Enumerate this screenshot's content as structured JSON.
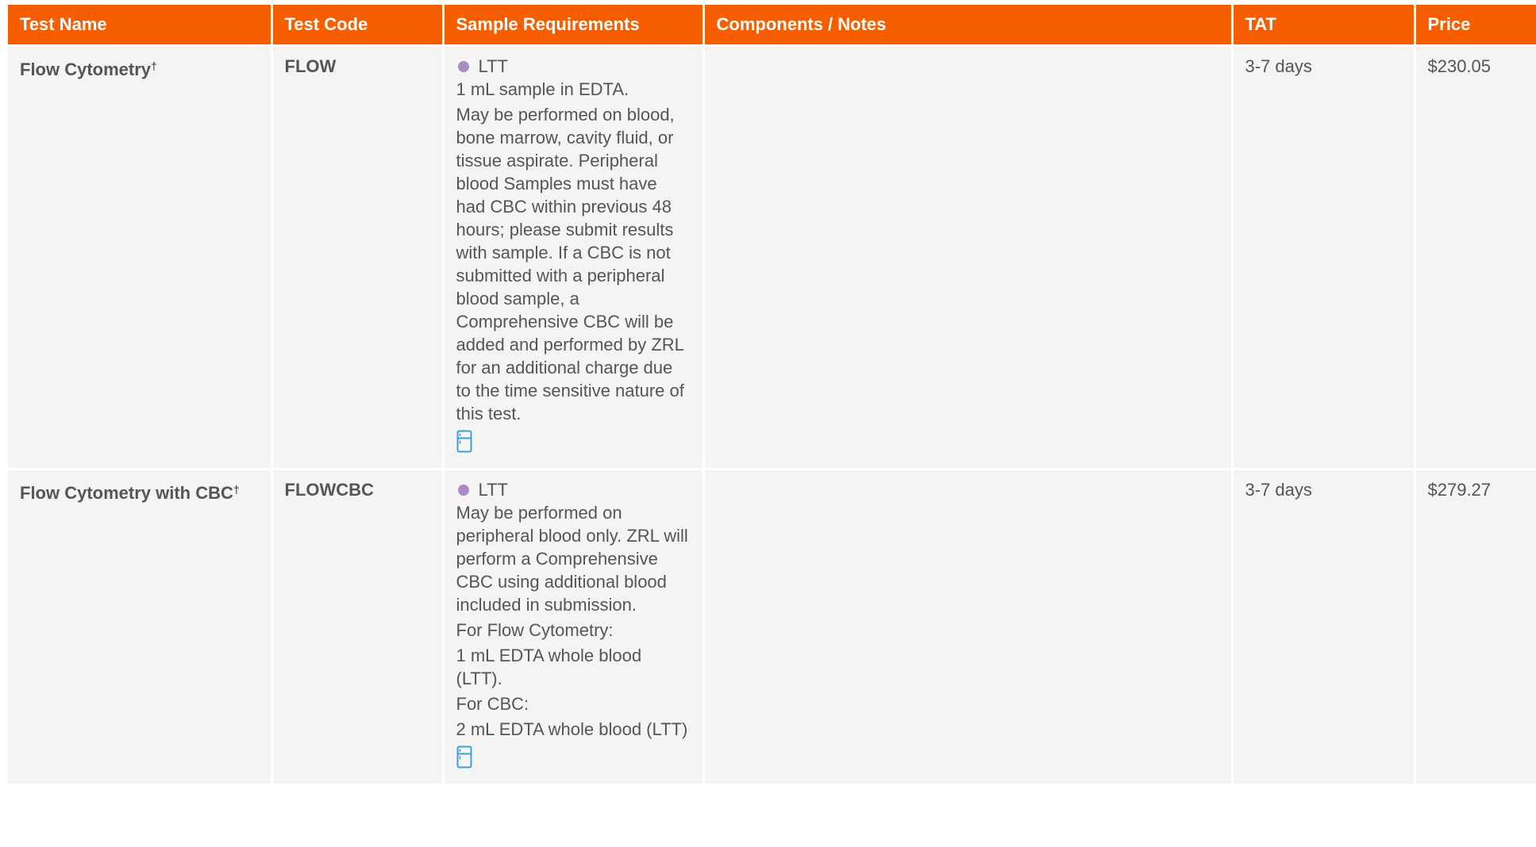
{
  "headers": [
    "Test Name",
    "Test Code",
    "Sample Requirements",
    "Components / Notes",
    "TAT",
    "Price"
  ],
  "rows": [
    {
      "name": "Flow Cytometry",
      "dagger": "†",
      "code": "FLOW",
      "tube_label": "LTT",
      "sample_paragraphs": [
        "1 mL sample in EDTA.",
        "May be performed on blood, bone marrow, cavity fluid, or tissue aspirate. Peripheral blood Samples must have had CBC within previous 48 hours; please submit results with sample. If a CBC is not submitted with a peripheral blood sample, a Comprehensive CBC will be added and performed by ZRL for an additional charge due to the time sensitive nature of this test."
      ],
      "notes": "",
      "tat": "3-7 days",
      "price": "$230.05",
      "icon": "refrigerator-icon"
    },
    {
      "name": "Flow Cytometry with CBC",
      "dagger": "†",
      "code": "FLOWCBC",
      "tube_label": "LTT",
      "sample_paragraphs": [
        "May be performed on peripheral blood only. ZRL will perform a Comprehensive CBC using additional blood included in submission.",
        "For Flow Cytometry:",
        "1 mL EDTA whole blood (LTT).",
        "For CBC:",
        "2 mL EDTA whole blood (LTT)"
      ],
      "notes": "",
      "tat": "3-7 days",
      "price": "$279.27",
      "icon": "refrigerator-icon"
    }
  ],
  "colors": {
    "header_bg": "#f75e00",
    "row_bg": "#f5f4f2",
    "tube_dot": "#a98bc6",
    "icon": "#3a9fd3",
    "text": "#555555"
  }
}
